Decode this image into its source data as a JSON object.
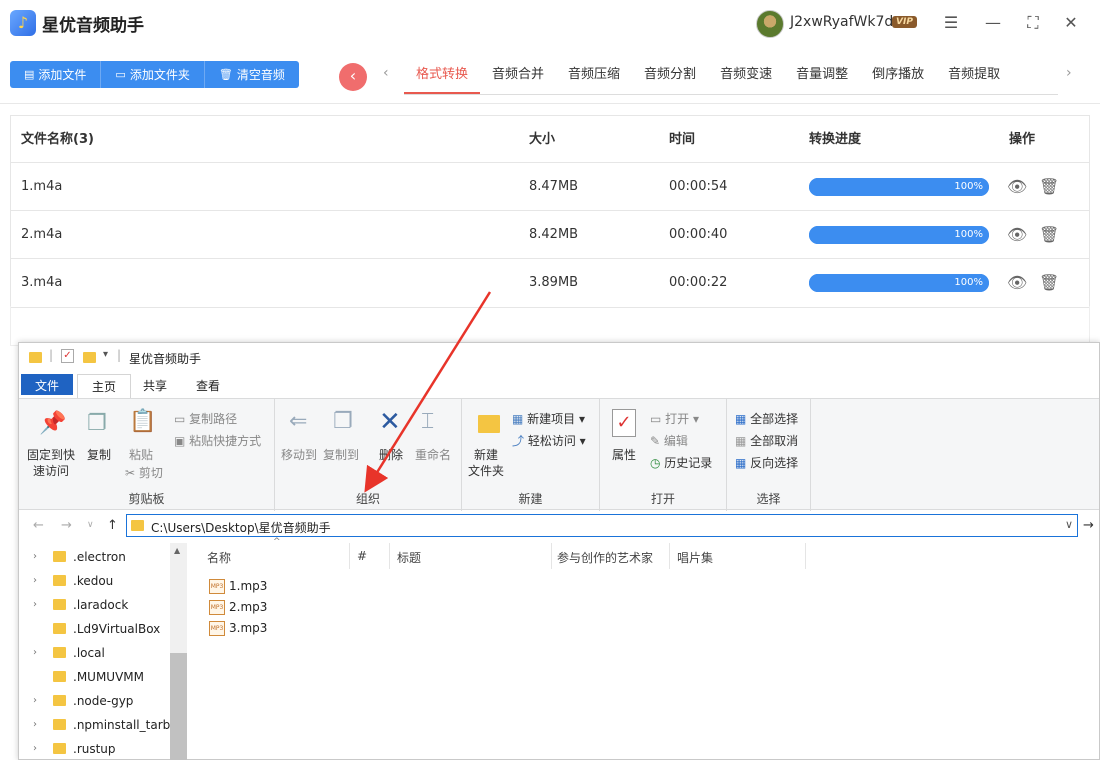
{
  "app": {
    "title": "星优音频助手",
    "logo_icon": "music-note-icon",
    "username": "J2xwRyafWk7d",
    "vip_badge": "VIP",
    "toolbar": {
      "add_file": "添加文件",
      "add_folder": "添加文件夹",
      "clear_audio": "清空音频"
    },
    "tabs": [
      "格式转换",
      "音频合并",
      "音频压缩",
      "音频分割",
      "音频变速",
      "音量调整",
      "倒序播放",
      "音频提取"
    ],
    "active_tab": 0,
    "table": {
      "headers": {
        "name": "文件名称(3)",
        "size": "大小",
        "time": "时间",
        "progress": "转换进度",
        "action": "操作"
      },
      "rows": [
        {
          "name": "1.m4a",
          "size": "8.47MB",
          "time": "00:00:54",
          "progress": "100%"
        },
        {
          "name": "2.m4a",
          "size": "8.42MB",
          "time": "00:00:40",
          "progress": "100%"
        },
        {
          "name": "3.m4a",
          "size": "3.89MB",
          "time": "00:00:22",
          "progress": "100%"
        }
      ]
    },
    "accent_color": "#3c8df0",
    "active_tab_color": "#e8594f"
  },
  "explorer": {
    "title": "星优音频助手",
    "ribbon_tabs": {
      "file": "文件",
      "home": "主页",
      "share": "共享",
      "view": "查看"
    },
    "clipboard": {
      "pin": "固定到快\n速访问",
      "pin_line1": "固定到快",
      "pin_line2": "速访问",
      "copy": "复制",
      "paste": "粘贴",
      "copy_path": "复制路径",
      "paste_shortcut": "粘贴快捷方式",
      "cut": "剪切",
      "label": "剪贴板"
    },
    "organize": {
      "move_to": "移动到",
      "copy_to": "复制到",
      "delete": "删除",
      "rename": "重命名",
      "label": "组织"
    },
    "new": {
      "new_folder_line1": "新建",
      "new_folder_line2": "文件夹",
      "new_item": "新建项目",
      "easy_access": "轻松访问",
      "label": "新建"
    },
    "open": {
      "properties": "属性",
      "open": "打开",
      "edit": "编辑",
      "history": "历史记录",
      "label": "打开"
    },
    "select": {
      "select_all": "全部选择",
      "select_none": "全部取消",
      "invert": "反向选择",
      "label": "选择"
    },
    "address": "C:\\Users\\Desktop\\星优音频助手",
    "tree": [
      ".electron",
      ".kedou",
      ".laradock",
      ".Ld9VirtualBox",
      ".local",
      ".MUMUVMM",
      ".node-gyp",
      ".npminstall_tarba",
      ".rustup"
    ],
    "tree_has_chevron": [
      true,
      true,
      true,
      false,
      true,
      false,
      true,
      true,
      true
    ],
    "columns": {
      "name": "名称",
      "num": "#",
      "title": "标题",
      "artist": "参与创作的艺术家",
      "album": "唱片集"
    },
    "files": [
      "1.mp3",
      "2.mp3",
      "3.mp3"
    ],
    "file_icon_text": "MP3"
  }
}
